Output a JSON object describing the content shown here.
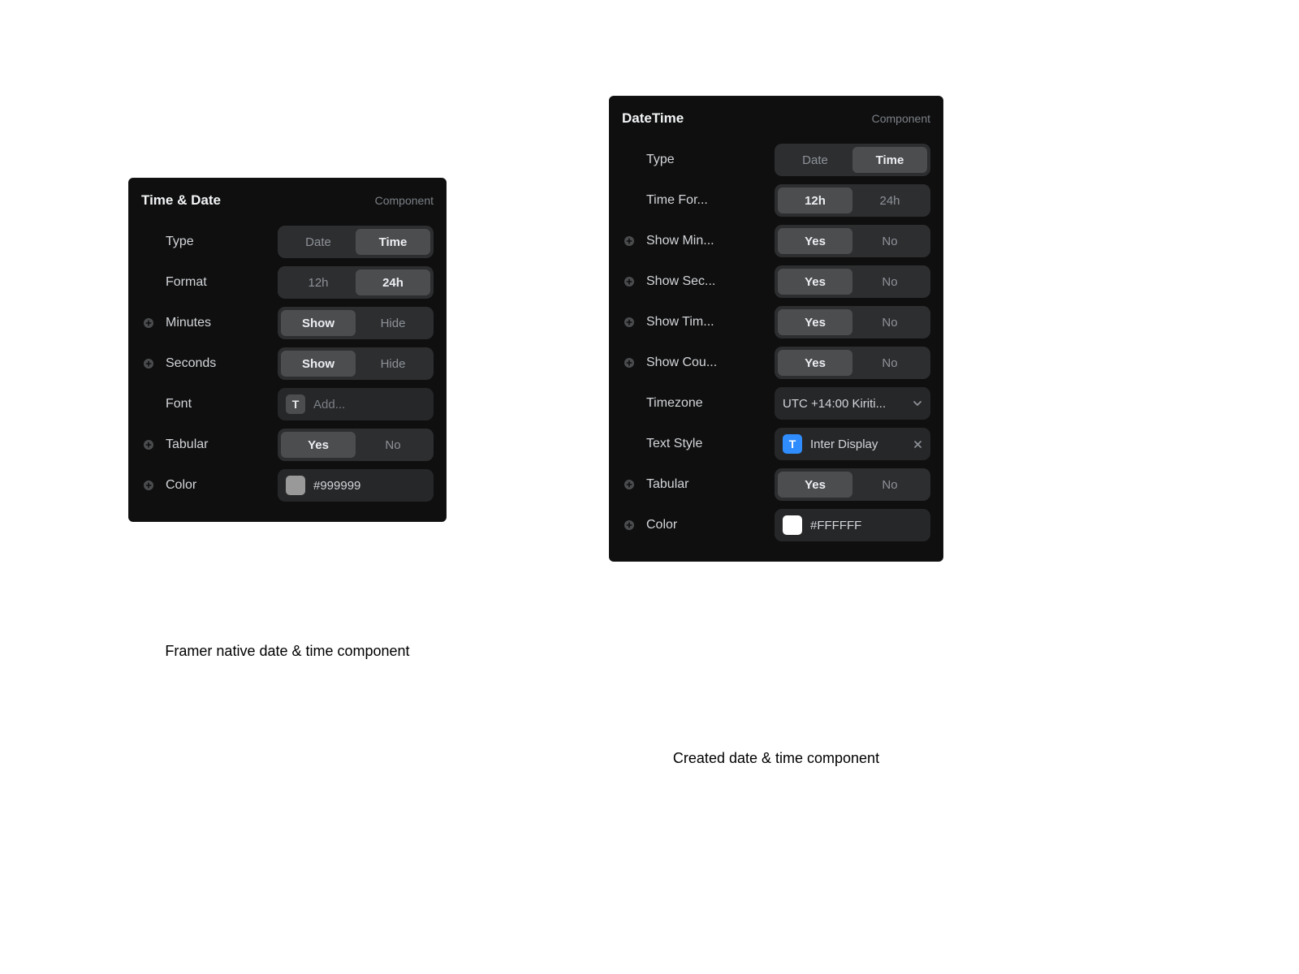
{
  "panelA": {
    "title": "Time & Date",
    "subtitle": "Component",
    "rows": {
      "type": {
        "label": "Type",
        "options": [
          "Date",
          "Time"
        ],
        "selected": 1
      },
      "format": {
        "label": "Format",
        "options": [
          "12h",
          "24h"
        ],
        "selected": 1
      },
      "minutes": {
        "label": "Minutes",
        "options": [
          "Show",
          "Hide"
        ],
        "selected": 0,
        "expandable": true
      },
      "seconds": {
        "label": "Seconds",
        "options": [
          "Show",
          "Hide"
        ],
        "selected": 0,
        "expandable": true
      },
      "font": {
        "label": "Font",
        "placeholder": "Add...",
        "value": "",
        "icon_letter": "T",
        "icon_bg": "#4c4d4f",
        "icon_fg": "#e8eaec"
      },
      "tabular": {
        "label": "Tabular",
        "options": [
          "Yes",
          "No"
        ],
        "selected": 0,
        "expandable": true
      },
      "color": {
        "label": "Color",
        "hex": "#999999",
        "swatch": "#999999",
        "expandable": true
      }
    }
  },
  "panelB": {
    "title": "DateTime",
    "subtitle": "Component",
    "rows": {
      "type": {
        "label": "Type",
        "options": [
          "Date",
          "Time"
        ],
        "selected": 1
      },
      "timeFormat": {
        "label": "Time For...",
        "options": [
          "12h",
          "24h"
        ],
        "selected": 0
      },
      "showMin": {
        "label": "Show Min...",
        "options": [
          "Yes",
          "No"
        ],
        "selected": 0,
        "expandable": true
      },
      "showSec": {
        "label": "Show Sec...",
        "options": [
          "Yes",
          "No"
        ],
        "selected": 0,
        "expandable": true
      },
      "showTim": {
        "label": "Show Tim...",
        "options": [
          "Yes",
          "No"
        ],
        "selected": 0,
        "expandable": true
      },
      "showCou": {
        "label": "Show Cou...",
        "options": [
          "Yes",
          "No"
        ],
        "selected": 0,
        "expandable": true
      },
      "timezone": {
        "label": "Timezone",
        "value": "UTC +14:00 Kiriti..."
      },
      "textStyle": {
        "label": "Text Style",
        "value": "Inter Display",
        "icon_letter": "T",
        "icon_bg": "#2f8dff",
        "icon_fg": "#ffffff"
      },
      "tabular": {
        "label": "Tabular",
        "options": [
          "Yes",
          "No"
        ],
        "selected": 0,
        "expandable": true
      },
      "color": {
        "label": "Color",
        "hex": "#FFFFFF",
        "swatch": "#ffffff",
        "expandable": true
      }
    }
  },
  "captions": {
    "a": "Framer native date & time component",
    "b": "Created date & time component"
  }
}
